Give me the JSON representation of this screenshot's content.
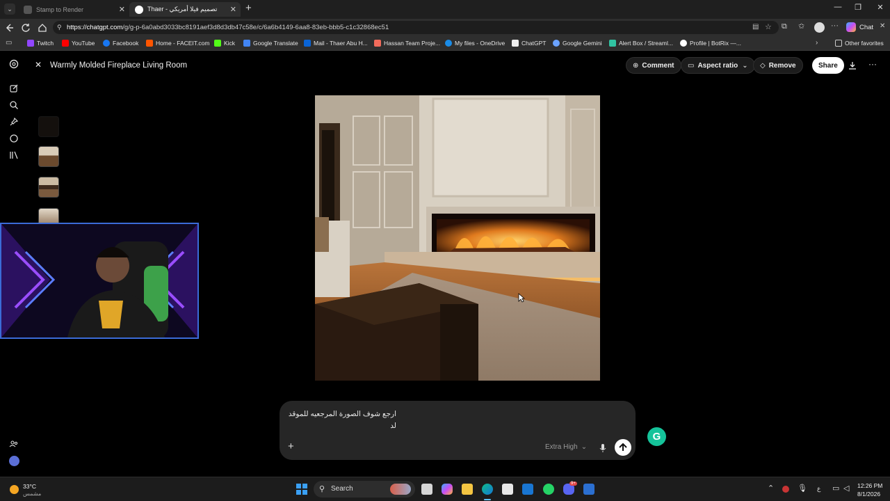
{
  "browser": {
    "tabs": [
      {
        "label": "Stamp to Render",
        "active": false
      },
      {
        "label": "Thaer - تصميم فيلا أمريكي",
        "active": true
      }
    ],
    "url_host": "https://chatgpt.com",
    "url_path": "/g/g-p-6a0abd3033bc8191aef3d8d3db47c58e/c/6a6b4149-6aa8-83eb-bbb5-c1c32868ec51",
    "copilot_label": "Chat",
    "bookmarks": [
      "Twitch",
      "YouTube",
      "Facebook",
      "Home - FACEIT.com",
      "Kick",
      "Google Translate",
      "Mail - Thaer Abu H...",
      "Hassan Team Proje...",
      "My files - OneDrive",
      "ChatGPT",
      "Google Gemini",
      "Alert Box / Streaml...",
      "Profile | BotRix —..."
    ],
    "other_favorites": "Other favorites"
  },
  "viewer": {
    "title": "Warmly Molded Fireplace Living Room",
    "comment_label": "Comment",
    "aspect_label": "Aspect ratio",
    "remove_label": "Remove",
    "share_label": "Share"
  },
  "composer": {
    "line1": "ارجع شوف الصورة المرجعيه للموقد",
    "line2": "لد",
    "model": "Extra High"
  },
  "taskbar": {
    "temp": "33°C",
    "weather": "مشمس",
    "search_label": "Search",
    "time": "12:26 PM",
    "date": "8/1/2026",
    "ime": "ع",
    "badge": "9+"
  },
  "colors": {
    "accent_send": "#ffffff",
    "grammarly": "#15c39a",
    "camera_border": "#3b6bd8"
  }
}
